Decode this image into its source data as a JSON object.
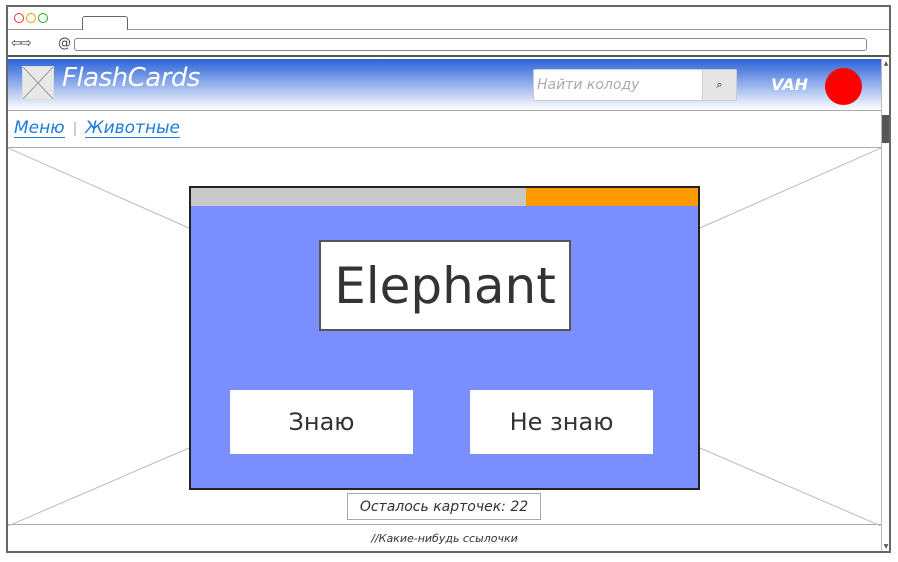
{
  "browser": {
    "nav_arrows": "⇦⇨",
    "url_prefix": "@",
    "url_value": ""
  },
  "header": {
    "brand": "FlashCards",
    "search": {
      "placeholder": "Найти колоду",
      "button_icon": "search-icon"
    },
    "user_name": "VAH",
    "avatar_color": "#ff0000",
    "gradient_top": "#2a63d8"
  },
  "breadcrumb": {
    "items": [
      {
        "label": "Меню"
      },
      {
        "label": "Животные"
      }
    ],
    "separator": "|"
  },
  "card": {
    "word": "Elephant",
    "progress_fraction_completed": 0.34,
    "progress_color": "#fd9a00",
    "card_color": "#7a8ffd",
    "know_label": "Знаю",
    "dont_know_label": "Не знаю"
  },
  "remaining": {
    "text": "Осталось карточек: 22"
  },
  "footer": {
    "text": "//Какие-нибудь ссылочки"
  }
}
